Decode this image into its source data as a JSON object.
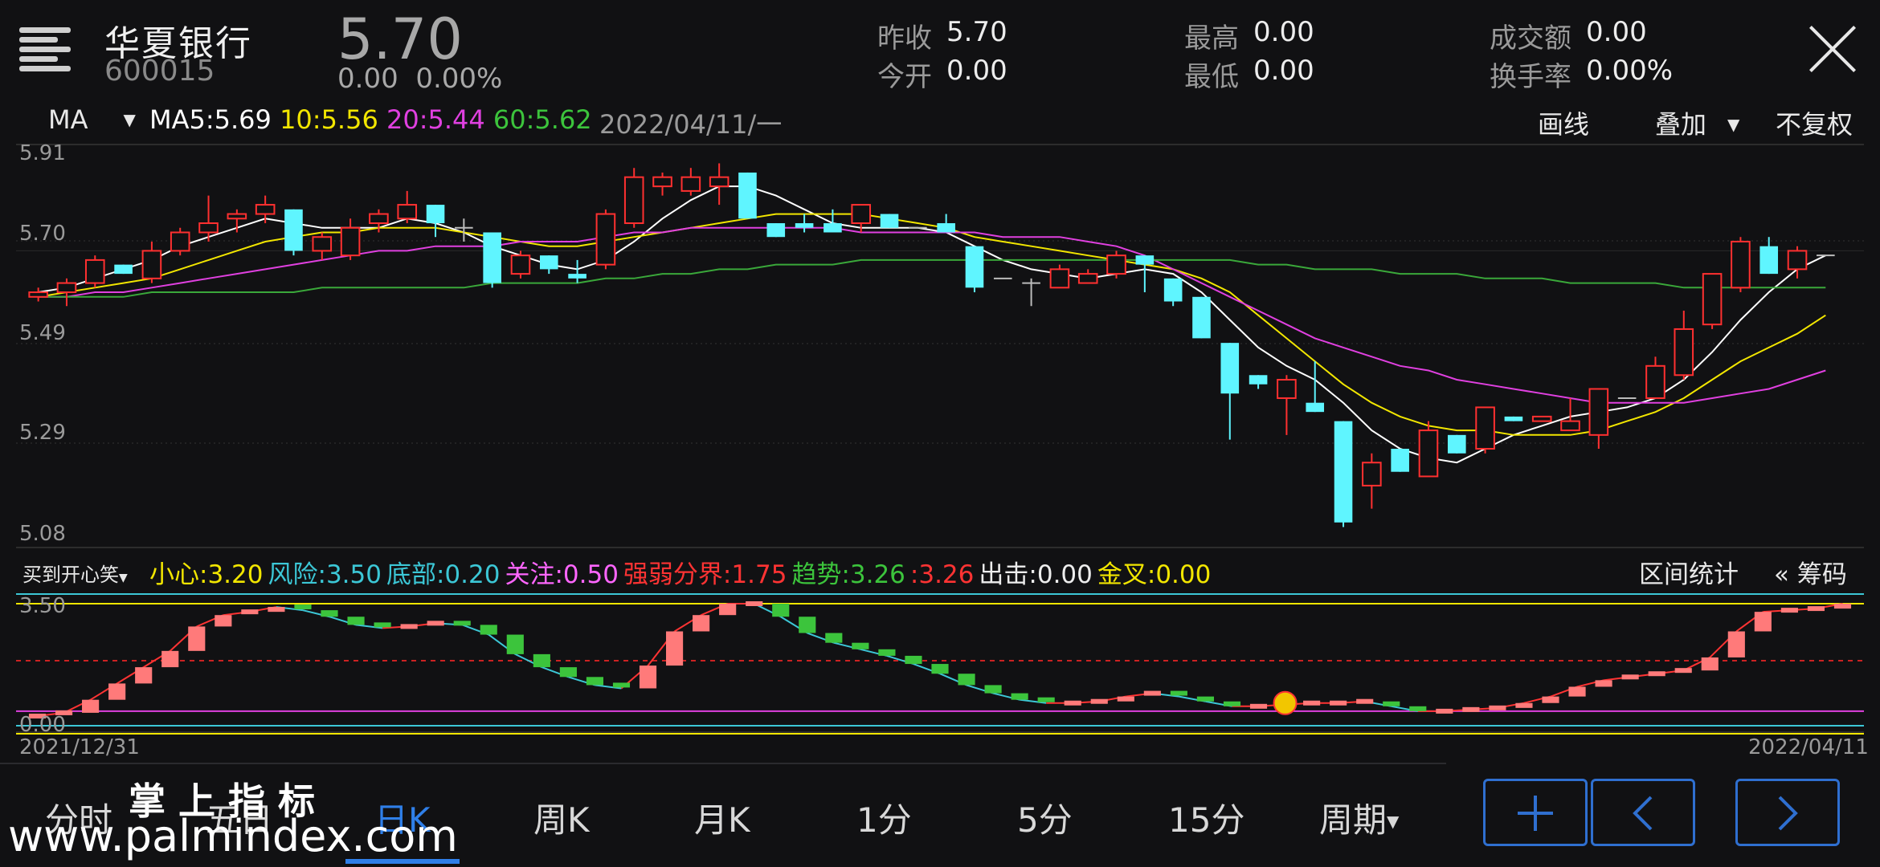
{
  "header": {
    "bank_name": "华夏银行",
    "code": "600015",
    "price": "5.70",
    "change": "0.00",
    "change_pct": "0.00%",
    "quotes": [
      {
        "label": "昨收",
        "value": "5.70"
      },
      {
        "label": "今开",
        "value": "0.00"
      },
      {
        "label": "最高",
        "value": "0.00"
      },
      {
        "label": "最低",
        "value": "0.00"
      },
      {
        "label": "成交额",
        "value": "0.00"
      },
      {
        "label": "换手率",
        "value": "0.00%"
      }
    ]
  },
  "ma_bar": {
    "selector": "MA",
    "ma5_label": "MA5:",
    "ma5": "5.69",
    "ma10_label": "10:",
    "ma10": "5.56",
    "ma20_label": "20:",
    "ma20": "5.44",
    "ma60_label": "60:",
    "ma60": "5.62",
    "date": "2022/04/11/一",
    "tools": [
      "画线",
      "叠加",
      "不复权"
    ]
  },
  "price_levels": [
    "5.91",
    "5.70",
    "5.49",
    "5.29",
    "5.08"
  ],
  "indicator_bar": {
    "name": "买到开心笑",
    "items": [
      {
        "label": "小心:",
        "value": "3.20",
        "color": "#f2e600"
      },
      {
        "label": "风险:",
        "value": "3.50",
        "color": "#3cc7d6"
      },
      {
        "label": "底部:",
        "value": "0.20",
        "color": "#3cc7d6"
      },
      {
        "label": "关注:",
        "value": "0.50",
        "color": "#ff66ff"
      },
      {
        "label": "强弱分界:",
        "value": "1.75",
        "color": "#ff3333"
      },
      {
        "label": "趋势:",
        "value": "3.26",
        "color": "#3cc43c"
      },
      {
        "label": ":",
        "value": "3.26",
        "color": "#ff3333"
      },
      {
        "label": "出击:",
        "value": "0.00",
        "color": "#ededed"
      },
      {
        "label": "金叉:",
        "value": "0.00",
        "color": "#f2e600"
      }
    ],
    "range_stats": "区间统计",
    "chips": "« 筹码"
  },
  "indicator_levels": [
    "3.50",
    "0.00"
  ],
  "dates": {
    "start": "2021/12/31",
    "end": "2022/04/11"
  },
  "tabs": [
    "分时",
    "五日",
    "日K",
    "周K",
    "月K",
    "1分",
    "5分",
    "15分",
    "周期"
  ],
  "active_tab": "日K",
  "watermark": {
    "line1": "掌 上 指 标",
    "line2": "www.palmindex.com"
  },
  "colors": {
    "up": "#ff3030",
    "down": "#5ff5ff",
    "ma5": "#ffffff",
    "ma10": "#f2e600",
    "ma20": "#e040e0",
    "ma60": "#3aa83a",
    "accent": "#2f6fd0"
  },
  "chart_data": [
    {
      "type": "candlestick",
      "ylim": [
        5.08,
        5.91
      ],
      "x": [
        "2021/12/31",
        "2022/04/11"
      ],
      "candles": [
        [
          5.6,
          5.62,
          5.59,
          5.61
        ],
        [
          5.61,
          5.64,
          5.58,
          5.63
        ],
        [
          5.63,
          5.69,
          5.62,
          5.68
        ],
        [
          5.67,
          5.66,
          5.65,
          5.65
        ],
        [
          5.64,
          5.72,
          5.63,
          5.7
        ],
        [
          5.7,
          5.75,
          5.69,
          5.74
        ],
        [
          5.74,
          5.82,
          5.72,
          5.76
        ],
        [
          5.77,
          5.79,
          5.74,
          5.78
        ],
        [
          5.78,
          5.82,
          5.76,
          5.8
        ],
        [
          5.79,
          5.78,
          5.69,
          5.7
        ],
        [
          5.7,
          5.74,
          5.68,
          5.73
        ],
        [
          5.69,
          5.77,
          5.68,
          5.75
        ],
        [
          5.76,
          5.79,
          5.74,
          5.78
        ],
        [
          5.77,
          5.83,
          5.76,
          5.8
        ],
        [
          5.8,
          5.79,
          5.73,
          5.76
        ],
        [
          5.75,
          5.77,
          5.72,
          5.75
        ],
        [
          5.74,
          5.73,
          5.62,
          5.63
        ],
        [
          5.65,
          5.7,
          5.64,
          5.69
        ],
        [
          5.69,
          5.68,
          5.65,
          5.66
        ],
        [
          5.65,
          5.68,
          5.63,
          5.64
        ],
        [
          5.67,
          5.79,
          5.66,
          5.78
        ],
        [
          5.76,
          5.88,
          5.75,
          5.86
        ],
        [
          5.84,
          5.87,
          5.82,
          5.86
        ],
        [
          5.83,
          5.88,
          5.82,
          5.86
        ],
        [
          5.84,
          5.89,
          5.8,
          5.86
        ],
        [
          5.87,
          5.86,
          5.77,
          5.77
        ],
        [
          5.76,
          5.75,
          5.73,
          5.73
        ],
        [
          5.76,
          5.78,
          5.74,
          5.75
        ],
        [
          5.76,
          5.79,
          5.74,
          5.74
        ],
        [
          5.76,
          5.8,
          5.74,
          5.8
        ],
        [
          5.78,
          5.77,
          5.75,
          5.75
        ],
        [
          5.75,
          5.75,
          5.75,
          5.75
        ],
        [
          5.76,
          5.78,
          5.74,
          5.74
        ],
        [
          5.71,
          5.71,
          5.61,
          5.62
        ],
        [
          5.64,
          5.64,
          5.64,
          5.64
        ],
        [
          5.63,
          5.64,
          5.58,
          5.63
        ],
        [
          5.62,
          5.67,
          5.62,
          5.66
        ],
        [
          5.63,
          5.66,
          5.64,
          5.65
        ],
        [
          5.65,
          5.7,
          5.64,
          5.69
        ],
        [
          5.69,
          5.68,
          5.61,
          5.67
        ],
        [
          5.64,
          5.64,
          5.58,
          5.59
        ],
        [
          5.6,
          5.59,
          5.51,
          5.51
        ],
        [
          5.5,
          5.49,
          5.29,
          5.39
        ],
        [
          5.43,
          5.43,
          5.4,
          5.41
        ],
        [
          5.38,
          5.43,
          5.3,
          5.42
        ],
        [
          5.37,
          5.46,
          5.35,
          5.35
        ],
        [
          5.33,
          5.33,
          5.1,
          5.11
        ],
        [
          5.19,
          5.26,
          5.14,
          5.24
        ],
        [
          5.27,
          5.27,
          5.23,
          5.22
        ],
        [
          5.21,
          5.33,
          5.21,
          5.31
        ],
        [
          5.3,
          5.29,
          5.26,
          5.26
        ],
        [
          5.27,
          5.36,
          5.26,
          5.36
        ],
        [
          5.34,
          5.34,
          5.33,
          5.33
        ],
        [
          5.33,
          5.34,
          5.34,
          5.34
        ],
        [
          5.31,
          5.38,
          5.31,
          5.33
        ],
        [
          5.3,
          5.39,
          5.27,
          5.4
        ],
        [
          5.38,
          5.38,
          5.38,
          5.38
        ],
        [
          5.38,
          5.47,
          5.38,
          5.45
        ],
        [
          5.43,
          5.57,
          5.42,
          5.53
        ],
        [
          5.54,
          5.65,
          5.53,
          5.65
        ],
        [
          5.62,
          5.73,
          5.61,
          5.72
        ],
        [
          5.71,
          5.73,
          5.66,
          5.65
        ],
        [
          5.66,
          5.71,
          5.64,
          5.7
        ],
        [
          5.69,
          5.69,
          5.69,
          5.69
        ]
      ],
      "series": [
        {
          "name": "MA5",
          "values": [
            5.61,
            5.62,
            5.64,
            5.66,
            5.68,
            5.71,
            5.73,
            5.75,
            5.77,
            5.76,
            5.75,
            5.75,
            5.75,
            5.77,
            5.76,
            5.74,
            5.71,
            5.69,
            5.67,
            5.66,
            5.68,
            5.72,
            5.77,
            5.81,
            5.84,
            5.84,
            5.82,
            5.79,
            5.76,
            5.75,
            5.75,
            5.75,
            5.74,
            5.71,
            5.68,
            5.66,
            5.65,
            5.64,
            5.65,
            5.66,
            5.65,
            5.61,
            5.55,
            5.49,
            5.45,
            5.42,
            5.37,
            5.31,
            5.27,
            5.25,
            5.24,
            5.27,
            5.3,
            5.32,
            5.34,
            5.35,
            5.36,
            5.38,
            5.42,
            5.48,
            5.55,
            5.61,
            5.66,
            5.69
          ]
        },
        {
          "name": "10",
          "values": [
            5.6,
            5.61,
            5.62,
            5.63,
            5.64,
            5.66,
            5.68,
            5.7,
            5.72,
            5.73,
            5.74,
            5.74,
            5.75,
            5.75,
            5.75,
            5.74,
            5.73,
            5.72,
            5.71,
            5.71,
            5.72,
            5.73,
            5.74,
            5.75,
            5.76,
            5.77,
            5.78,
            5.78,
            5.78,
            5.78,
            5.77,
            5.76,
            5.75,
            5.73,
            5.72,
            5.71,
            5.7,
            5.69,
            5.68,
            5.67,
            5.66,
            5.64,
            5.61,
            5.56,
            5.51,
            5.46,
            5.41,
            5.37,
            5.34,
            5.32,
            5.31,
            5.31,
            5.3,
            5.3,
            5.3,
            5.31,
            5.33,
            5.35,
            5.38,
            5.42,
            5.46,
            5.49,
            5.52,
            5.56
          ]
        },
        {
          "name": "20",
          "values": [
            5.6,
            5.6,
            5.61,
            5.61,
            5.62,
            5.63,
            5.64,
            5.65,
            5.66,
            5.67,
            5.68,
            5.69,
            5.7,
            5.7,
            5.71,
            5.71,
            5.71,
            5.72,
            5.72,
            5.72,
            5.73,
            5.74,
            5.74,
            5.75,
            5.75,
            5.75,
            5.75,
            5.75,
            5.75,
            5.74,
            5.74,
            5.74,
            5.74,
            5.74,
            5.73,
            5.73,
            5.73,
            5.72,
            5.71,
            5.69,
            5.66,
            5.63,
            5.6,
            5.57,
            5.54,
            5.51,
            5.49,
            5.47,
            5.45,
            5.44,
            5.42,
            5.41,
            5.4,
            5.39,
            5.38,
            5.37,
            5.37,
            5.37,
            5.37,
            5.38,
            5.39,
            5.4,
            5.42,
            5.44
          ]
        },
        {
          "name": "60",
          "values": [
            5.6,
            5.6,
            5.6,
            5.6,
            5.61,
            5.61,
            5.61,
            5.61,
            5.61,
            5.61,
            5.62,
            5.62,
            5.62,
            5.62,
            5.62,
            5.62,
            5.63,
            5.63,
            5.63,
            5.63,
            5.64,
            5.64,
            5.65,
            5.65,
            5.66,
            5.66,
            5.67,
            5.67,
            5.67,
            5.68,
            5.68,
            5.68,
            5.68,
            5.68,
            5.68,
            5.68,
            5.68,
            5.68,
            5.68,
            5.68,
            5.68,
            5.68,
            5.68,
            5.67,
            5.67,
            5.66,
            5.66,
            5.66,
            5.65,
            5.65,
            5.65,
            5.64,
            5.64,
            5.64,
            5.63,
            5.63,
            5.63,
            5.63,
            5.62,
            5.62,
            5.62,
            5.62,
            5.62,
            5.62
          ]
        }
      ]
    },
    {
      "type": "bar",
      "ylim": [
        0,
        3.5
      ],
      "series": [
        {
          "name": "趋势",
          "values": [
            0.05,
            0.15,
            0.55,
            1.05,
            1.55,
            2.05,
            2.8,
            3.15,
            3.25,
            3.4,
            3.3,
            3.1,
            2.85,
            2.75,
            2.8,
            2.9,
            2.85,
            2.55,
            1.95,
            1.55,
            1.25,
            1.0,
            0.9,
            1.6,
            2.65,
            3.15,
            3.5,
            3.5,
            3.1,
            2.6,
            2.3,
            2.1,
            1.9,
            1.65,
            1.35,
            1.0,
            0.75,
            0.55,
            0.45,
            0.45,
            0.5,
            0.65,
            0.75,
            0.65,
            0.5,
            0.35,
            0.35,
            0.4,
            0.45,
            0.45,
            0.5,
            0.35,
            0.2,
            0.2,
            0.25,
            0.3,
            0.45,
            0.65,
            0.95,
            1.15,
            1.25,
            1.35,
            1.45,
            1.85,
            2.65,
            3.25,
            3.3,
            3.35,
            3.5
          ]
        }
      ],
      "lines": {
        "小心": 3.2,
        "风险": 3.5,
        "底部": 0.2,
        "关注": 0.5,
        "强弱分界": 1.75
      }
    }
  ]
}
